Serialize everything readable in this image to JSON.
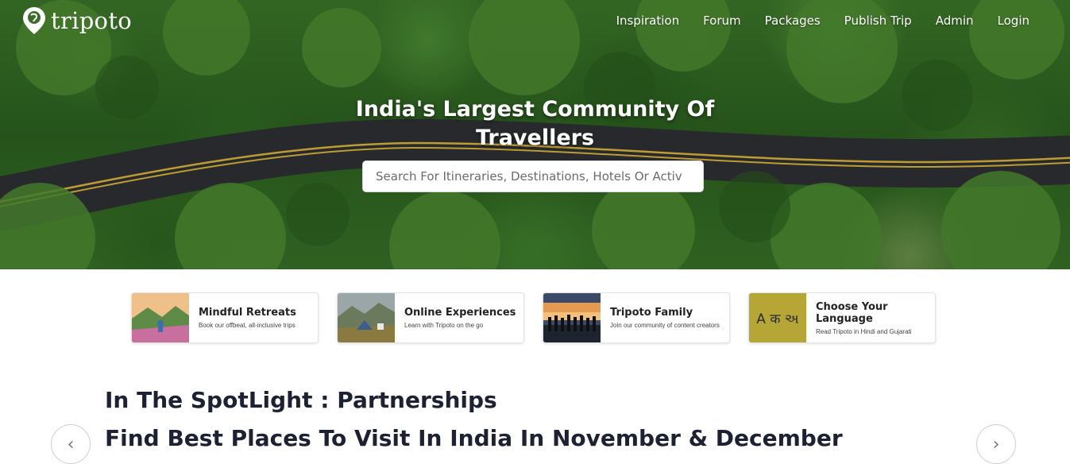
{
  "brand": {
    "name": "tripoto"
  },
  "nav": {
    "items": [
      "Inspiration",
      "Forum",
      "Packages",
      "Publish Trip",
      "Admin",
      "Login"
    ]
  },
  "hero": {
    "headline_line1": "India's Largest Community Of",
    "headline_line2": "Travellers",
    "search_placeholder": "Search For Itineraries, Destinations, Hotels Or Activ"
  },
  "cards": [
    {
      "title": "Mindful Retreats",
      "subtitle": "Book our offbeat, all-inclusive trips",
      "icon": "mountain-photo"
    },
    {
      "title": "Online Experiences",
      "subtitle": "Learn with Tripoto on the go",
      "icon": "camping-photo"
    },
    {
      "title": "Tripoto Family",
      "subtitle": "Join our community of content creators",
      "icon": "sunset-people-photo"
    },
    {
      "title": "Choose Your Language",
      "subtitle": "Read Tripoto in Hindi and Gujarati",
      "icon": "language-icon",
      "icon_text": "A क અ"
    }
  ],
  "section": {
    "title": "In The SpotLight : Partnerships",
    "subtitle": "Find Best Places To Visit In India In November & December",
    "prev_arrow": "‹",
    "next_arrow": "›"
  },
  "colors": {
    "heading": "#1c2233",
    "language_tile": "#b5a636"
  }
}
